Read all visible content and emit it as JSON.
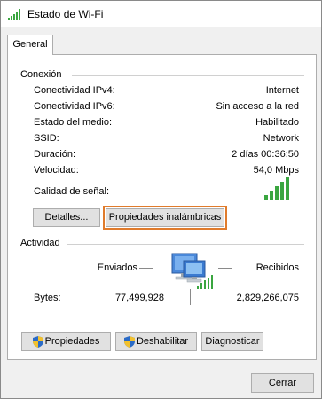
{
  "window": {
    "title": "Estado de Wi-Fi"
  },
  "tabs": [
    {
      "label": "General"
    }
  ],
  "connection": {
    "group_title": "Conexión",
    "rows": [
      {
        "label": "Conectividad IPv4:",
        "value": "Internet"
      },
      {
        "label": "Conectividad IPv6:",
        "value": "Sin acceso a la red"
      },
      {
        "label": "Estado del medio:",
        "value": "Habilitado"
      },
      {
        "label": "SSID:",
        "value": "Network"
      },
      {
        "label": "Duración:",
        "value": "2 días 00:36:50"
      },
      {
        "label": "Velocidad:",
        "value": "54,0 Mbps"
      }
    ],
    "signal_label": "Calidad de señal:",
    "signal_bars_filled": 5,
    "signal_bars_total": 5,
    "details_button": "Detalles...",
    "wireless_props_button": "Propiedades inalámbricas"
  },
  "activity": {
    "group_title": "Actividad",
    "sent_label": "Enviados",
    "received_label": "Recibidos",
    "bytes_label": "Bytes:",
    "bytes_sent": "77,499,928",
    "bytes_received": "2,829,266,075",
    "properties_button": "Propiedades",
    "disable_button": "Deshabilitar",
    "diagnose_button": "Diagnosticar"
  },
  "footer": {
    "close_button": "Cerrar"
  },
  "colors": {
    "signal_green": "#3aa640",
    "focus_outline": "#e07b2c",
    "shield_blue": "#2a6bc7",
    "shield_yellow": "#f2c12e"
  }
}
